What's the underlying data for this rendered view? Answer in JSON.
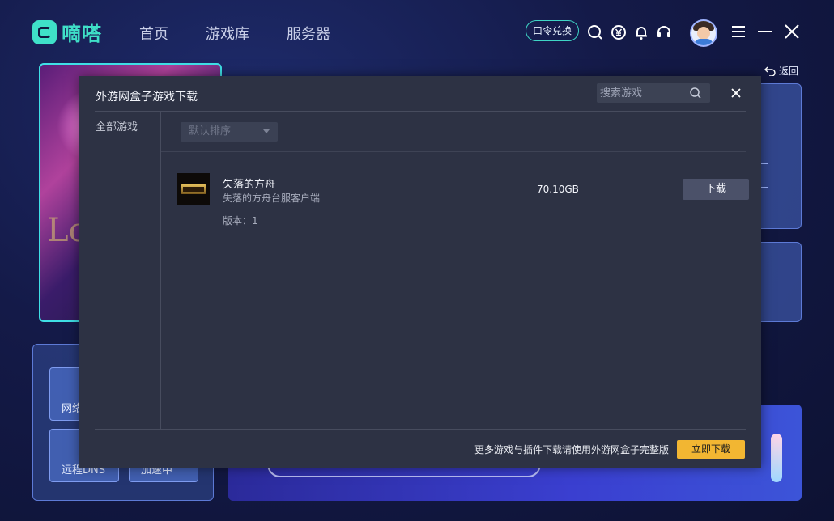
{
  "app": {
    "name": "嘀嗒"
  },
  "nav": [
    {
      "label": "首页"
    },
    {
      "label": "游戏库"
    },
    {
      "label": "服务器"
    }
  ],
  "topbar": {
    "redeem_label": "口令兑换",
    "icons": [
      "search-icon",
      "yuan-icon",
      "bell-icon",
      "headset-icon",
      "menu-icon",
      "minimize-icon",
      "close-icon"
    ]
  },
  "background": {
    "back_label": "返回",
    "art_text": "Lo",
    "tools": [
      "网络",
      "远程DNS",
      "加速中"
    ]
  },
  "modal": {
    "title": "外游网盒子游戏下载",
    "search_placeholder": "搜索游戏",
    "category": "全部游戏",
    "sort_label": "默认排序",
    "games": [
      {
        "name": "失落的方舟",
        "subtitle": "失落的方舟台服客户端",
        "version": "版本：1",
        "size": "70.10GB",
        "action": "下载"
      }
    ],
    "footer_text": "更多游戏与插件下载请使用外游网盒子完整版",
    "footer_button": "立即下载"
  },
  "colors": {
    "accent": "#3fe0c8",
    "modal_bg": "#2d3244",
    "primary_button": "#f2b632",
    "secondary_button": "#4b5169"
  }
}
